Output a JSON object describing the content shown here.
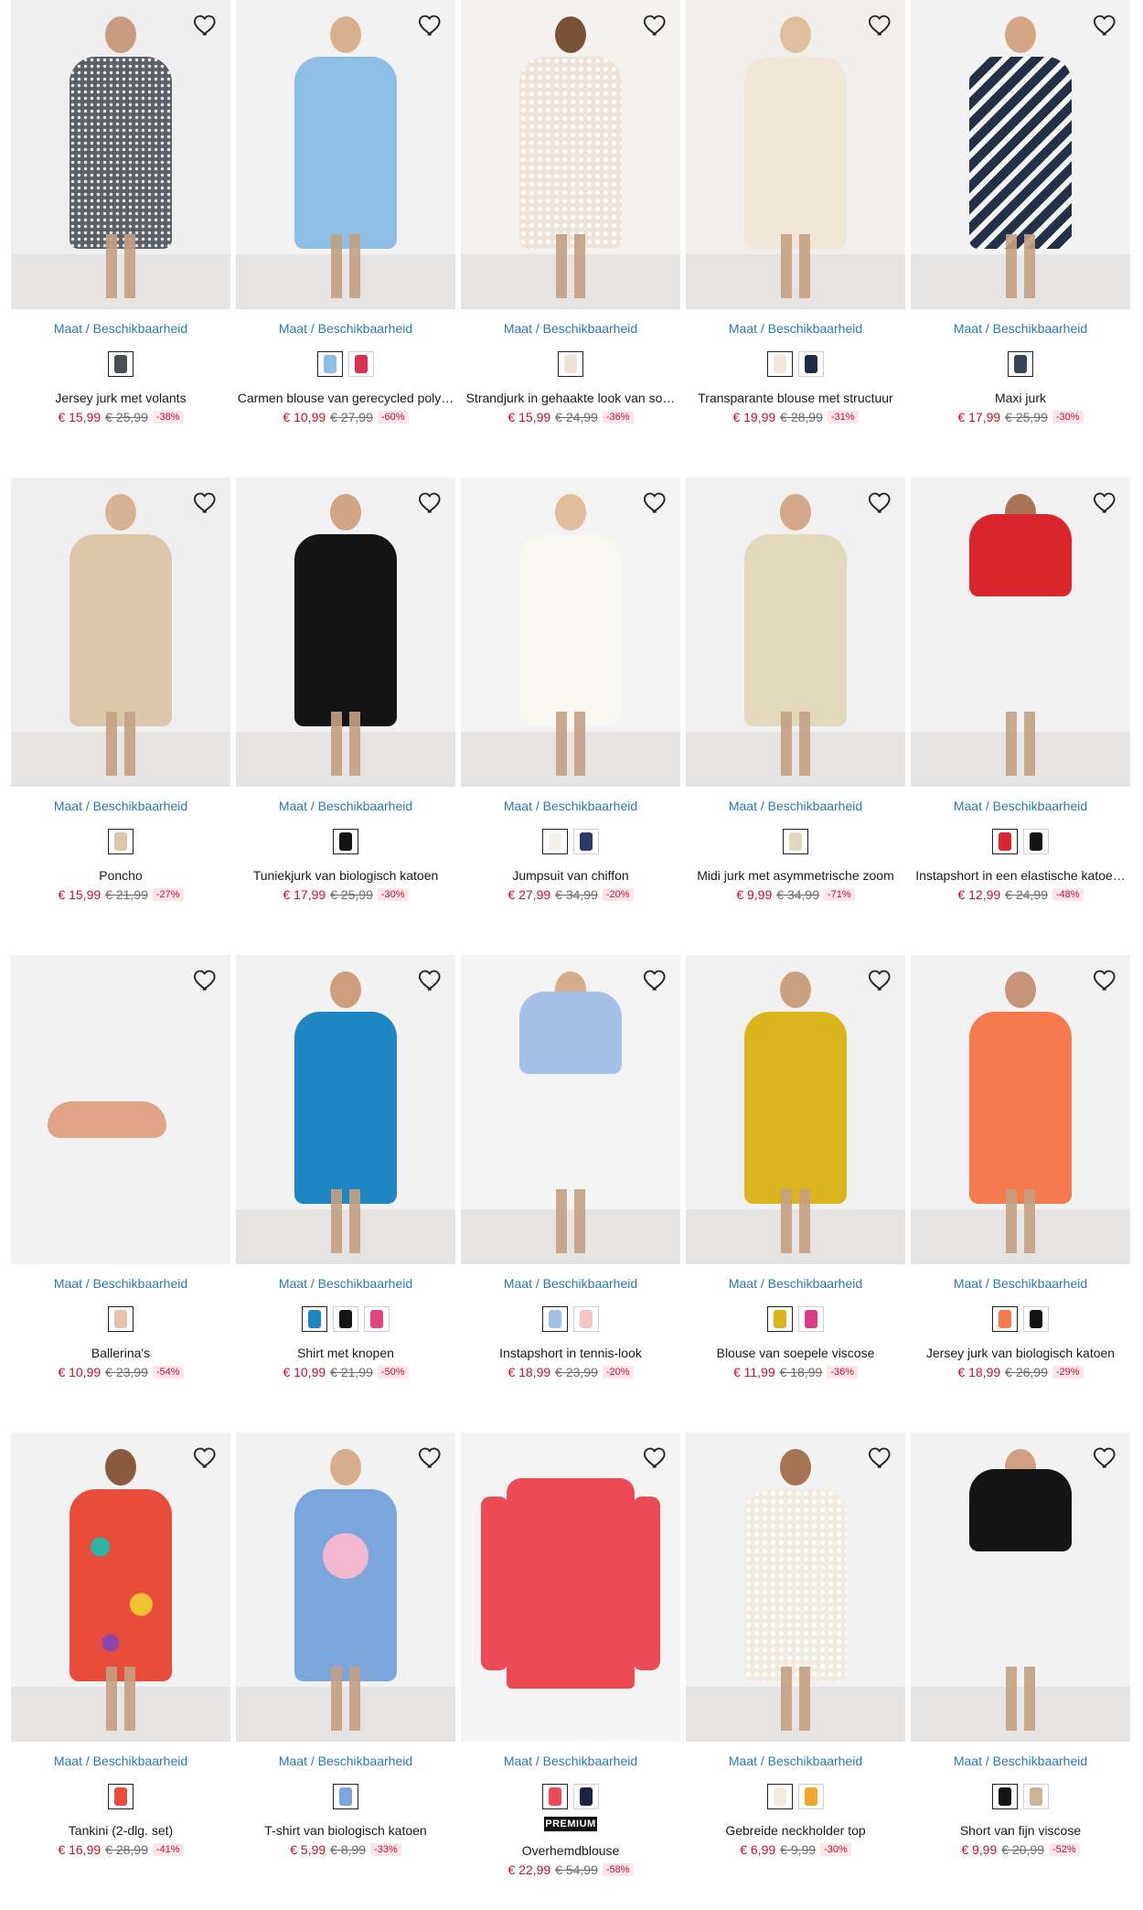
{
  "availability_label": "Maat / Beschikbaarheid",
  "products": [
    {
      "name": "Jersey jurk met volants",
      "price": "€ 15,99",
      "old_price": "€ 25,99",
      "discount": "-38%",
      "photo": {
        "bg": "#efefef",
        "garment": "#5a6066",
        "skin": "#c89c7c",
        "pattern": "dots"
      },
      "swatches": [
        "#4a4f55"
      ],
      "premium": false
    },
    {
      "name": "Carmen blouse van gerecycled poly…",
      "price": "€ 10,99",
      "old_price": "€ 27,99",
      "discount": "-60%",
      "photo": {
        "bg": "#f2f2f2",
        "garment": "#8ebde6",
        "skin": "#d9b08e",
        "pattern": ""
      },
      "swatches": [
        "#8ebde6",
        "#d8314f"
      ],
      "premium": false
    },
    {
      "name": "Strandjurk in gehaakte look van so…",
      "price": "€ 15,99",
      "old_price": "€ 24,99",
      "discount": "-36%",
      "photo": {
        "bg": "#f4f2ee",
        "garment": "#ede3d6",
        "skin": "#7b5038",
        "pattern": "crochet"
      },
      "swatches": [
        "#ede3d6"
      ],
      "premium": false
    },
    {
      "name": "Transparante blouse met structuur",
      "price": "€ 19,99",
      "old_price": "€ 28,99",
      "discount": "-31%",
      "photo": {
        "bg": "#f1efec",
        "garment": "#f1e6d7",
        "skin": "#e0bea0",
        "pattern": ""
      },
      "swatches": [
        "#f1e6d7",
        "#1f2a44"
      ],
      "premium": false
    },
    {
      "name": "Maxi jurk",
      "price": "€ 17,99",
      "old_price": "€ 25,99",
      "discount": "-30%",
      "photo": {
        "bg": "#f2f2f2",
        "garment": "#233048",
        "skin": "#d5a684",
        "pattern": "stripes"
      },
      "swatches": [
        "#3a4458"
      ],
      "premium": false
    },
    {
      "name": "Poncho",
      "price": "€ 15,99",
      "old_price": "€ 21,99",
      "discount": "-27%",
      "photo": {
        "bg": "#efefef",
        "garment": "#dcc7ab",
        "skin": "#d8b393",
        "pattern": ""
      },
      "swatches": [
        "#dcc7ab"
      ],
      "premium": false
    },
    {
      "name": "Tuniekjurk van biologisch katoen",
      "price": "€ 17,99",
      "old_price": "€ 25,99",
      "discount": "-30%",
      "photo": {
        "bg": "#f2f2f2",
        "garment": "#141414",
        "skin": "#d2a584",
        "pattern": ""
      },
      "swatches": [
        "#141414"
      ],
      "premium": false
    },
    {
      "name": "Jumpsuit van chiffon",
      "price": "€ 27,99",
      "old_price": "€ 34,99",
      "discount": "-20%",
      "photo": {
        "bg": "#f3f3f3",
        "garment": "#f8f6f1",
        "skin": "#e2bb99",
        "pattern": ""
      },
      "swatches": [
        "#f3f0ea",
        "#2c3a6b"
      ],
      "premium": false
    },
    {
      "name": "Midi jurk met asymmetrische zoom",
      "price": "€ 9,99",
      "old_price": "€ 34,99",
      "discount": "-71%",
      "photo": {
        "bg": "#f1f1f1",
        "garment": "#e2d9bd",
        "skin": "#d4a98a",
        "pattern": ""
      },
      "swatches": [
        "#e2d9bd"
      ],
      "premium": false
    },
    {
      "name": "Instapshort in een elastische katoe…",
      "price": "€ 12,99",
      "old_price": "€ 24,99",
      "discount": "-48%",
      "photo": {
        "bg": "#f2f2f2",
        "garment": "#d9262c",
        "skin": "#a87454",
        "pattern": "short"
      },
      "swatches": [
        "#d9262c",
        "#141414"
      ],
      "premium": false
    },
    {
      "name": "Ballerina's",
      "price": "€ 10,99",
      "old_price": "€ 23,99",
      "discount": "-54%",
      "photo": {
        "bg": "#f2f2f2",
        "garment": "#e0a586",
        "skin": "#f2f2f2",
        "pattern": "shoe"
      },
      "swatches": [
        "#e6c2a8"
      ],
      "premium": false
    },
    {
      "name": "Shirt met knopen",
      "price": "€ 10,99",
      "old_price": "€ 21,99",
      "discount": "-50%",
      "photo": {
        "bg": "#f2f2f2",
        "garment": "#1f86c4",
        "skin": "#cf9f7d",
        "pattern": ""
      },
      "swatches": [
        "#1f86c4",
        "#141414",
        "#e0457f"
      ],
      "premium": false
    },
    {
      "name": "Instapshort in tennis-look",
      "price": "€ 18,99",
      "old_price": "€ 23,99",
      "discount": "-20%",
      "photo": {
        "bg": "#f3f3f3",
        "garment": "#a6bfe6",
        "skin": "#d6ac8b",
        "pattern": "short"
      },
      "swatches": [
        "#a6bfe6",
        "#f3c4c4"
      ],
      "premium": false
    },
    {
      "name": "Blouse van soepele viscose",
      "price": "€ 11,99",
      "old_price": "€ 18,99",
      "discount": "-36%",
      "photo": {
        "bg": "#f1f1f1",
        "garment": "#d9b41c",
        "skin": "#caa07e",
        "pattern": ""
      },
      "swatches": [
        "#d9b41c",
        "#d93d85"
      ],
      "premium": false
    },
    {
      "name": "Jersey jurk van biologisch katoen",
      "price": "€ 18,99",
      "old_price": "€ 26,99",
      "discount": "-29%",
      "photo": {
        "bg": "#f2f2f2",
        "garment": "#f57a4d",
        "skin": "#c7957a",
        "pattern": ""
      },
      "swatches": [
        "#f57a4d",
        "#141414"
      ],
      "premium": false
    },
    {
      "name": "Tankini (2-dlg. set)",
      "price": "€ 16,99",
      "old_price": "€ 28,99",
      "discount": "-41%",
      "photo": {
        "bg": "#f2f2f2",
        "garment": "#e84d3c",
        "skin": "#8a5a3c",
        "pattern": "tropical"
      },
      "swatches": [
        "#e84d3c"
      ],
      "premium": false
    },
    {
      "name": "T-shirt van biologisch katoen",
      "price": "€ 5,99",
      "old_price": "€ 8,99",
      "discount": "-33%",
      "photo": {
        "bg": "#f2f2f2",
        "garment": "#7ba6dc",
        "skin": "#d8ad8c",
        "pattern": "print"
      },
      "swatches": [
        "#7ba6dc"
      ],
      "premium": false
    },
    {
      "name": "Overhemdblouse",
      "price": "€ 22,99",
      "old_price": "€ 54,99",
      "discount": "-58%",
      "photo": {
        "bg": "#f4f4f4",
        "garment": "#ee4a55",
        "skin": "#f4f4f4",
        "pattern": "flat"
      },
      "swatches": [
        "#ee4a55",
        "#1b2440"
      ],
      "premium": true,
      "premium_label": "PREMIUM"
    },
    {
      "name": "Gebreide neckholder top",
      "price": "€ 6,99",
      "old_price": "€ 9,99",
      "discount": "-30%",
      "photo": {
        "bg": "#f2f2f2",
        "garment": "#f2ece0",
        "skin": "#a67455",
        "pattern": "crochet"
      },
      "swatches": [
        "#f2ece0",
        "#f0a72a"
      ],
      "premium": false
    },
    {
      "name": "Short van fijn viscose",
      "price": "€ 9,99",
      "old_price": "€ 20,99",
      "discount": "-52%",
      "photo": {
        "bg": "#f2f2f2",
        "garment": "#141414",
        "skin": "#d1a080",
        "pattern": "short"
      },
      "swatches": [
        "#141414",
        "#c8b59a"
      ],
      "premium": false
    }
  ]
}
